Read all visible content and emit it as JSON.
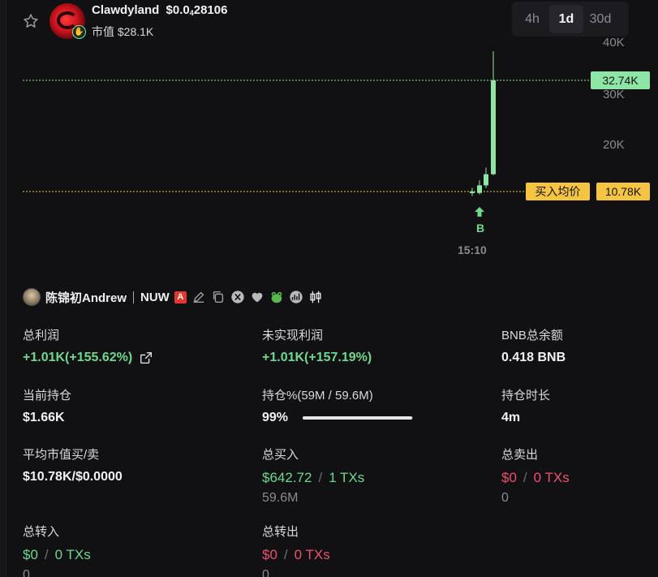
{
  "token": {
    "name": "Clawdyland",
    "price_prefix": "$0.0",
    "price_zeros": "4",
    "price_digits": "28106",
    "mcap": "市值 $28.1K"
  },
  "timeframes": [
    {
      "label": "4h",
      "active": false
    },
    {
      "label": "1d",
      "active": true
    },
    {
      "label": "30d",
      "active": false
    }
  ],
  "chart": {
    "y_ticks": [
      "40K",
      "30K",
      "20K"
    ],
    "current_price_tag": "32.74K",
    "avg_buy_label": "买入均价",
    "avg_buy_value": "10.78K",
    "buy_marker": "B",
    "time_label": "15:10",
    "colors": {
      "up": "#8ee6a6",
      "avg_line": "#f5c542",
      "current_line": "#8ee6a6"
    }
  },
  "chart_data": {
    "type": "candlestick",
    "x": [
      "15:10"
    ],
    "ylim": [
      0,
      45000
    ],
    "series": [
      {
        "values": [
          {
            "open": 10780,
            "high": 11500,
            "low": 9900,
            "close": 10500
          },
          {
            "open": 10500,
            "high": 13000,
            "low": 10200,
            "close": 12000
          },
          {
            "open": 12000,
            "high": 15500,
            "low": 11500,
            "close": 14200
          },
          {
            "open": 14200,
            "high": 38500,
            "low": 14000,
            "close": 32740
          }
        ]
      }
    ],
    "annotations": [
      "32.74K",
      "买入均价 10.78K",
      "B"
    ]
  },
  "trader": {
    "name": "陈锦初Andrew",
    "tag": "NUW",
    "badge": "A"
  },
  "stats": {
    "total_profit": {
      "label": "总利润",
      "value": "+1.01K(+155.62%)"
    },
    "unrealized_profit": {
      "label": "未实现利润",
      "value": "+1.01K(+157.19%)"
    },
    "bnb_balance": {
      "label": "BNB总余额",
      "value": "0.418 BNB"
    },
    "current_position": {
      "label": "当前持仓",
      "value": "$1.66K"
    },
    "holding_pct": {
      "label": "持仓%(59M / 59.6M)",
      "value": "99%",
      "fraction": 0.99
    },
    "holding_time": {
      "label": "持仓时长",
      "value": "4m"
    },
    "avg_mcap": {
      "label": "平均市值买/卖",
      "value": "$10.78K/$0.0000"
    },
    "total_buy": {
      "label": "总买入",
      "amount": "$642.72",
      "slash": "/",
      "txs": "1 TXs",
      "sub": "59.6M"
    },
    "total_sell": {
      "label": "总卖出",
      "amount": "$0",
      "slash": "/",
      "txs": "0 TXs",
      "sub": "0"
    },
    "total_transfer_in": {
      "label": "总转入",
      "amount": "$0",
      "slash": "/",
      "txs": "0 TXs",
      "sub": "0"
    },
    "total_transfer_out": {
      "label": "总转出",
      "amount": "$0",
      "slash": "/",
      "txs": "0 TXs",
      "sub": "0"
    }
  }
}
